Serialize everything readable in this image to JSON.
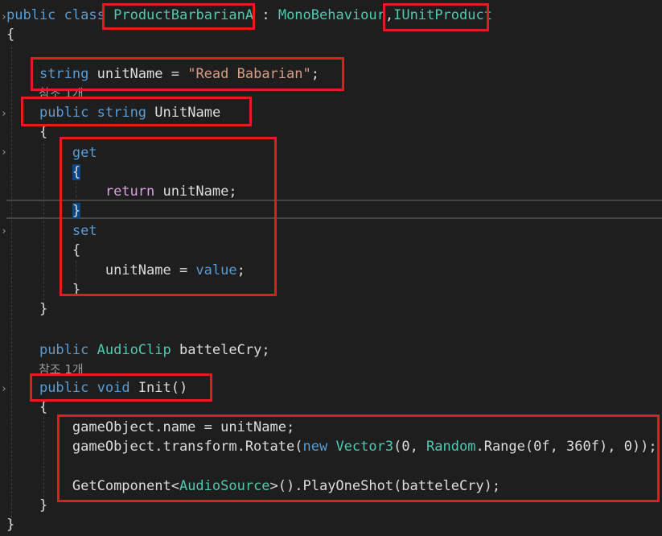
{
  "class_decl": {
    "kw_public": "public",
    "kw_class": "class",
    "class_name": "ProductBarbarianA",
    "colon": " : ",
    "base_class": "MonoBehaviour",
    "comma": ",",
    "interface": "IUnitProduct"
  },
  "lines": {
    "open_class": "{",
    "field_kw": "string",
    "field_rest": " unitName = ",
    "field_value": "\"Read Babarian\"",
    "field_end": ";",
    "ref1": "참조 1개",
    "prop_public": "public",
    "prop_string": "string",
    "prop_name": "UnitName",
    "prop_open": "{",
    "get_kw": "get",
    "get_open": "{",
    "return_kw": "return",
    "return_rest": " unitName;",
    "get_close": "}",
    "set_kw": "set",
    "set_open": "{",
    "assign_left": "unitName = ",
    "assign_value": "value",
    "assign_end": ";",
    "set_close": "}",
    "prop_close": "}",
    "audio_public": "public",
    "audio_type": "AudioClip",
    "audio_rest": " batteleCry;",
    "ref2": "참조 1개",
    "init_public": "public",
    "init_void": "void",
    "init_name": " Init()",
    "init_open": "{",
    "go_name": "gameObject.name = unitName;",
    "rot_pre": "gameObject.transform.Rotate(",
    "rot_new": "new",
    "rot_vec": "Vector3",
    "rot_args1": "(0, ",
    "rot_random": "Random",
    "rot_range": ".Range(0f, 360f), 0));",
    "gc_pre": "GetComponent<",
    "gc_type": "AudioSource",
    "gc_post": ">().PlayOneShot(batteleCry);",
    "init_close": "}",
    "class_close": "}"
  },
  "colors": {
    "background": "#1e1e1e",
    "keyword": "#569cd6",
    "control_keyword": "#d8a0df",
    "type": "#4ec9b0",
    "string": "#d69d85",
    "annotation_box": "#e31b23"
  }
}
